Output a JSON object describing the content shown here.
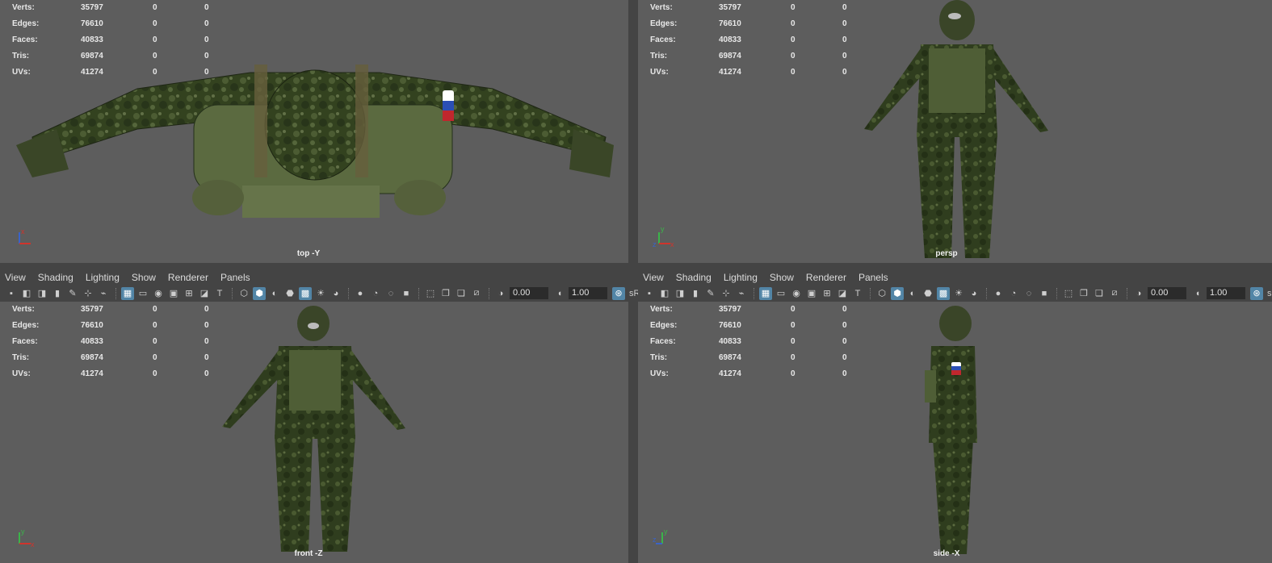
{
  "viewports": {
    "top": {
      "label": "top -Y"
    },
    "persp": {
      "label": "persp"
    },
    "front": {
      "label": "front -Z"
    },
    "side": {
      "label": "side -X"
    }
  },
  "hud": {
    "rows": [
      {
        "label": "Verts:",
        "v1": "35797",
        "v2": "0",
        "v3": "0"
      },
      {
        "label": "Edges:",
        "v1": "76610",
        "v2": "0",
        "v3": "0"
      },
      {
        "label": "Faces:",
        "v1": "40833",
        "v2": "0",
        "v3": "0"
      },
      {
        "label": "Tris:",
        "v1": "69874",
        "v2": "0",
        "v3": "0"
      },
      {
        "label": "UVs:",
        "v1": "41274",
        "v2": "0",
        "v3": "0"
      }
    ]
  },
  "panel_menu": [
    "View",
    "Shading",
    "Lighting",
    "Show",
    "Renderer",
    "Panels"
  ],
  "toolbar": {
    "exposure_value": "0.00",
    "gamma_value": "1.00",
    "colorspace_label": "sR"
  },
  "colors": {
    "viewport_bg": "#5d5d5d",
    "ui_bg": "#444444",
    "accent": "#5285a6",
    "camo_dark": "#2f3d22",
    "camo_light": "#54643a"
  }
}
